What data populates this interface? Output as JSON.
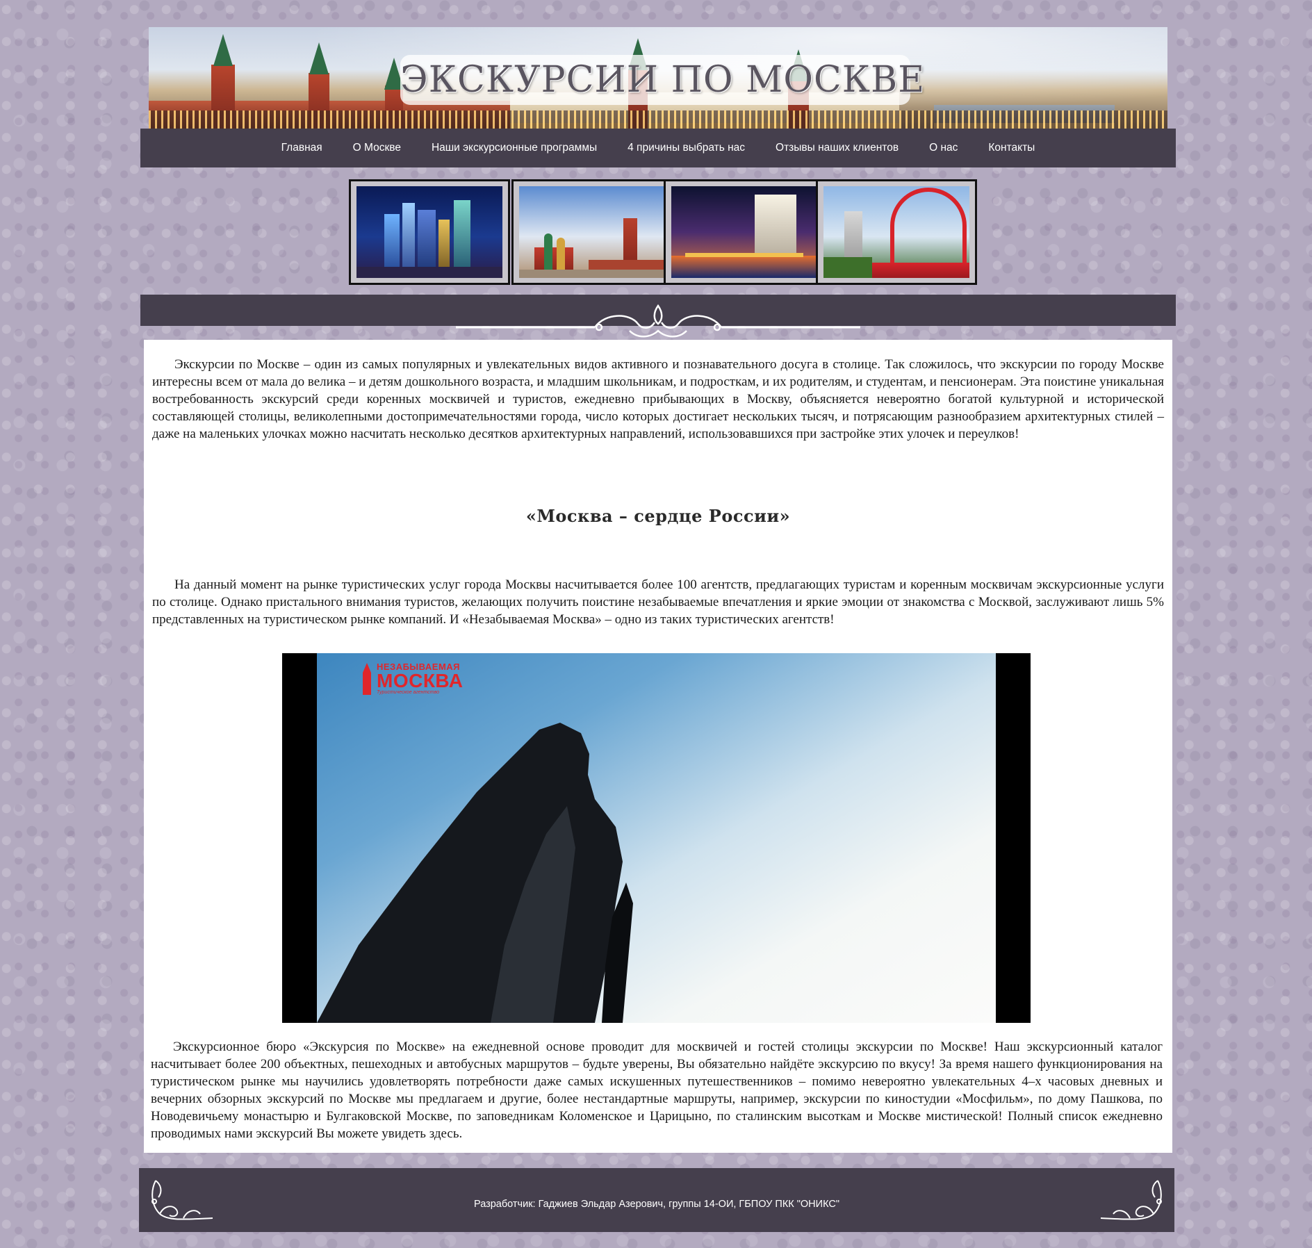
{
  "header": {
    "title": "ЭКСКУРСИИ ПО МОСКВЕ"
  },
  "nav": {
    "items": [
      {
        "label": "Главная"
      },
      {
        "label": "О Москве"
      },
      {
        "label": "Наши экскурсионные программы"
      },
      {
        "label": "4 причины выбрать нас"
      },
      {
        "label": "Отзывы наших клиентов"
      },
      {
        "label": "О нас"
      },
      {
        "label": "Контакты"
      }
    ]
  },
  "gallery": {
    "thumbs": [
      {
        "icon": "moscow-city-skyscrapers"
      },
      {
        "icon": "red-square-st-basils"
      },
      {
        "icon": "moscow-river-night"
      },
      {
        "icon": "zhivopisny-bridge"
      }
    ]
  },
  "content": {
    "intro": "Экскурсии по Москве – один из самых популярных и увлекательных видов активного и познавательного досуга в столице. Так сложилось, что экскурсии по городу Москве интересны всем от мала до велика – и детям дошкольного возраста, и младшим школьникам, и подросткам, и их родителям, и студентам, и пенсионерам. Эта поистине уникальная востребованность экскурсий среди коренных москвичей и туристов, ежедневно прибывающих в Москву, объясняется невероятно богатой культурной и исторической составляющей столицы, великолепными достопримечательностями города, число которых достигает нескольких тысяч, и потрясающим разнообразием архитектурных стилей – даже на маленьких улочках можно насчитать несколько десятков архитектурных направлений, использовавшихся при застройке этих улочек и переулков!",
    "heading": "«Москва – сердце России»",
    "para2": "На данный момент на рынке туристических услуг города Москвы насчитывается более 100 агентств, предлагающих туристам и коренным москвичам экскурсионные услуги по столице. Однако пристального внимания туристов, желающих получить поистине незабываемые впечатления и яркие эмоции от знакомства с Москвой, заслуживают лишь 5% представленных на туристическом рынке компаний. И «Незабываемая Москва» – одно из таких туристических агентств!",
    "video": {
      "logo_line1": "НЕЗАБЫВАЕМАЯ",
      "logo_line2": "МОСКВА",
      "logo_line3": "Туристическое агентство"
    },
    "para3": "Экскурсионное бюро «Экскурсия по Москве» на ежедневной основе проводит для москвичей и гостей столицы экскурсии по Москве! Наш экскурсионный каталог насчитывает более 200 объектных, пешеходных и автобусных маршрутов – будьте уверены, Вы обязательно найдёте экскурсию по вкусу! За время нашего функционирования на туристическом рынке мы научились удовлетворять потребности даже самых искушенных путешественников – помимо невероятно увлекательных 4–х часовых дневных и вечерних обзорных экскурсий по Москве мы предлагаем и другие, более нестандартные маршруты, например, экскурсии по киностудии «Мосфильм», по дому Пашкова, по Новодевичьему монастырю и Булгаковской Москве, по заповедникам Коломенское и Царицыно, по сталинским высоткам и Москве мистической! Полный список ежедневно проводимых нами экскурсий Вы можете увидеть здесь."
  },
  "footer": {
    "text": "Разработчик: Гаджиев Эльдар Азерович, группы 14-ОИ, ГБПОУ ПКК \"ОНИКС\""
  },
  "colors": {
    "page_bg": "#b3aac0",
    "bar": "#453f4d",
    "content_bg": "#ffffff",
    "logo_red": "#e0262b"
  }
}
